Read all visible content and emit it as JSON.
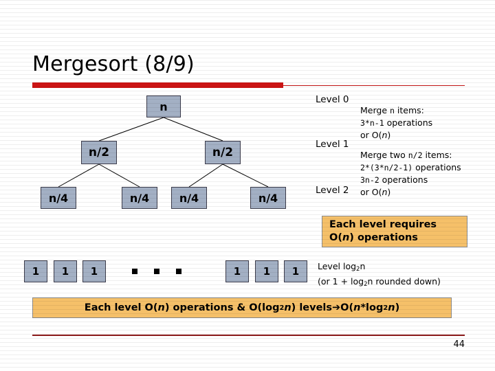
{
  "slide": {
    "title": "Mergesort (8/9)",
    "page_number": "44"
  },
  "tree": {
    "root": {
      "label": "n"
    },
    "level1": [
      {
        "label": "n/2"
      },
      {
        "label": "n/2"
      }
    ],
    "level2": [
      {
        "label": "n/4"
      },
      {
        "label": "n/4"
      },
      {
        "label": "n/4"
      },
      {
        "label": "n/4"
      }
    ],
    "leaves": [
      {
        "label": "1"
      },
      {
        "label": "1"
      },
      {
        "label": "1"
      },
      {
        "label": "1"
      },
      {
        "label": "1"
      },
      {
        "label": "1"
      }
    ],
    "ellipsis_count": 3
  },
  "annotations": {
    "level_0_label": "Level 0",
    "level_1_label": "Level 1",
    "level_2_label": "Level 2",
    "note_0": {
      "line1_prefix": "Merge ",
      "line1_mono": "n",
      "line1_suffix": " items:",
      "line2_mono": "3*n-1",
      "line2_suffix": " operations",
      "line3_prefix": "or O(",
      "line3_italic": "n",
      "line3_suffix": ")"
    },
    "note_1": {
      "line1_prefix": "Merge two ",
      "line1_mono": "n/2",
      "line1_suffix": " items:",
      "line2_mono": "2*(3*n/2-1)",
      "line2_suffix": " operations",
      "line3_mono": "3n-2",
      "line3_suffix": " operations",
      "line4_prefix": "or O(",
      "line4_italic": "n",
      "line4_suffix": ")"
    },
    "log_level": {
      "line1_prefix": "Level log",
      "line1_sub": "2",
      "line1_suffix": "n",
      "line2_prefix": "(or 1 + log",
      "line2_sub": "2",
      "line2_suffix": "n rounded down)"
    }
  },
  "callout": {
    "line1": "Each level requires",
    "line2_prefix": "O(",
    "line2_italic": "n",
    "line2_suffix": ") operations"
  },
  "banner": {
    "seg1": "Each level O(",
    "seg2_italic": "n",
    "seg3": ") operations & O(log",
    "seg4_sub": "2",
    "seg5_italic": "n",
    "seg6": ") levels ",
    "seg7_arrow": "➔",
    "seg8": " O(",
    "seg9_italic": "n",
    "seg10": "*log",
    "seg11_sub": "2",
    "seg12_italic": "n",
    "seg13": ")"
  },
  "colors": {
    "node_fill": "#a3b0c4",
    "node_border": "#3b3b4a",
    "accent_red": "#cc1414",
    "footer_red": "#8b1a1a",
    "callout_orange": "#f5c069"
  }
}
